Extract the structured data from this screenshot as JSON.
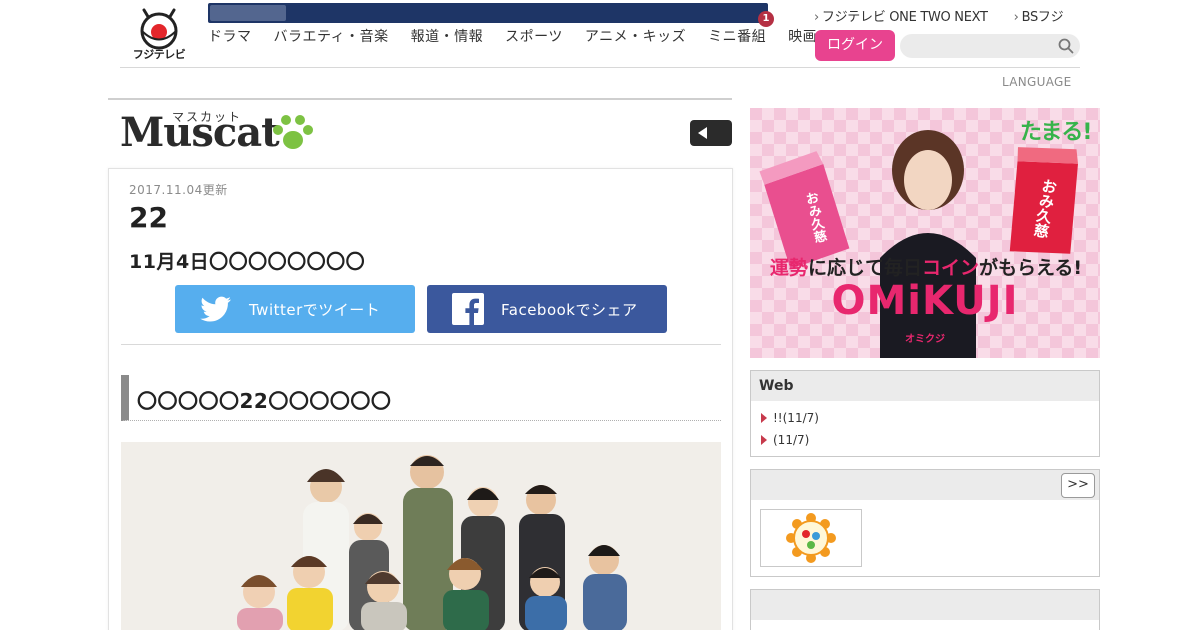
{
  "global_header": {
    "logo_text": "フジテレビ",
    "nav_items": [
      "ドラマ",
      "バラエティ・音楽",
      "報道・情報",
      "スポーツ",
      "アニメ・キッズ",
      "ミニ番組",
      "映画"
    ],
    "notification_count": "1",
    "top_links": [
      "フジテレビ ONE TWO NEXT",
      "BSフジ"
    ],
    "login_label": "ログイン",
    "search_value": "",
    "language_label": "LANGUAGE"
  },
  "muscat": {
    "logo_text": "Muscat",
    "logo_kana": "マスカット"
  },
  "article": {
    "date": "2017.11.04更新",
    "title": "22",
    "subtitle": "11月4日〇〇〇〇〇〇〇〇",
    "twitter_label": "Twitterでツイート",
    "facebook_label": "Facebookでシェア",
    "section_heading": "〇〇〇〇〇22〇〇〇〇〇〇",
    "photo_alt": "cast group photo"
  },
  "sidebar": {
    "banner": {
      "brand": "たまる!",
      "catch_parts": [
        "運勢",
        "に応じて毎日",
        "コイン",
        "がもらえる!"
      ],
      "title": "OMiKUJI",
      "title_kana": "オミクジ",
      "box_left_text": "おみ久慈",
      "box_right_text": "おみ久慈"
    },
    "web_box": {
      "title": "Web",
      "items": [
        "!!(11/7)",
        "(11/7)"
      ]
    },
    "more_box": {
      "more_label": ">>",
      "thumb_label": "めざましテレビ"
    }
  },
  "colors": {
    "header_bar": "#1e3566",
    "login_pink": "#e8438f",
    "twitter_blue": "#56aeee",
    "facebook_blue": "#3b589d",
    "paw_green": "#7dc243",
    "bullet_red": "#c73a4c"
  },
  "icons": {
    "search": "search-icon",
    "paw": "paw-icon",
    "prev": "triangle-left-icon",
    "twitter": "twitter-bird-icon",
    "facebook": "facebook-f-icon"
  }
}
